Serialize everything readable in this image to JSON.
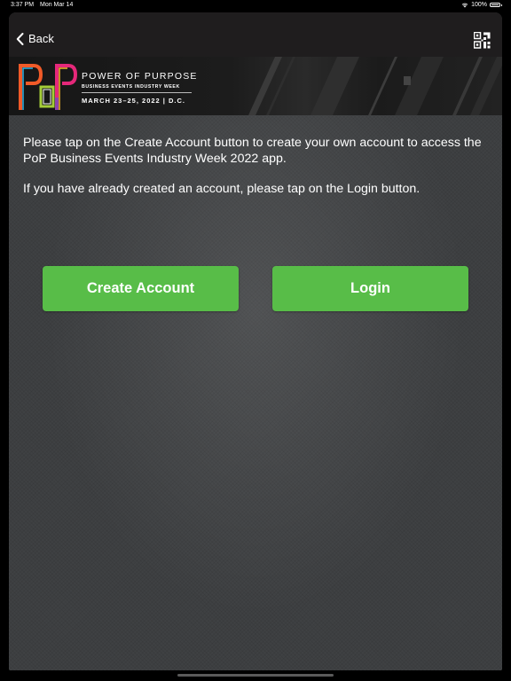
{
  "status_bar": {
    "time": "3:37 PM",
    "date": "Mon Mar 14",
    "battery": "100%"
  },
  "nav": {
    "back_label": "Back",
    "qr_icon": "qr-code-icon"
  },
  "banner": {
    "logo_text": "PoP",
    "title": "POWER OF PURPOSE",
    "subtitle": "BUSINESS EVENTS INDUSTRY WEEK",
    "dates": "MARCH 23–25, 2022 | D.C."
  },
  "main": {
    "paragraph_1": "Please tap on the Create Account button to create your own account to access the PoP Business Events Industry Week 2022 app.",
    "paragraph_2": "If you have already created an account, please tap on the Login button.",
    "create_account_label": "Create Account",
    "login_label": "Login"
  },
  "colors": {
    "button_green": "#58bd48",
    "nav_background": "#1f1d1e",
    "content_background": "#3f4143"
  }
}
